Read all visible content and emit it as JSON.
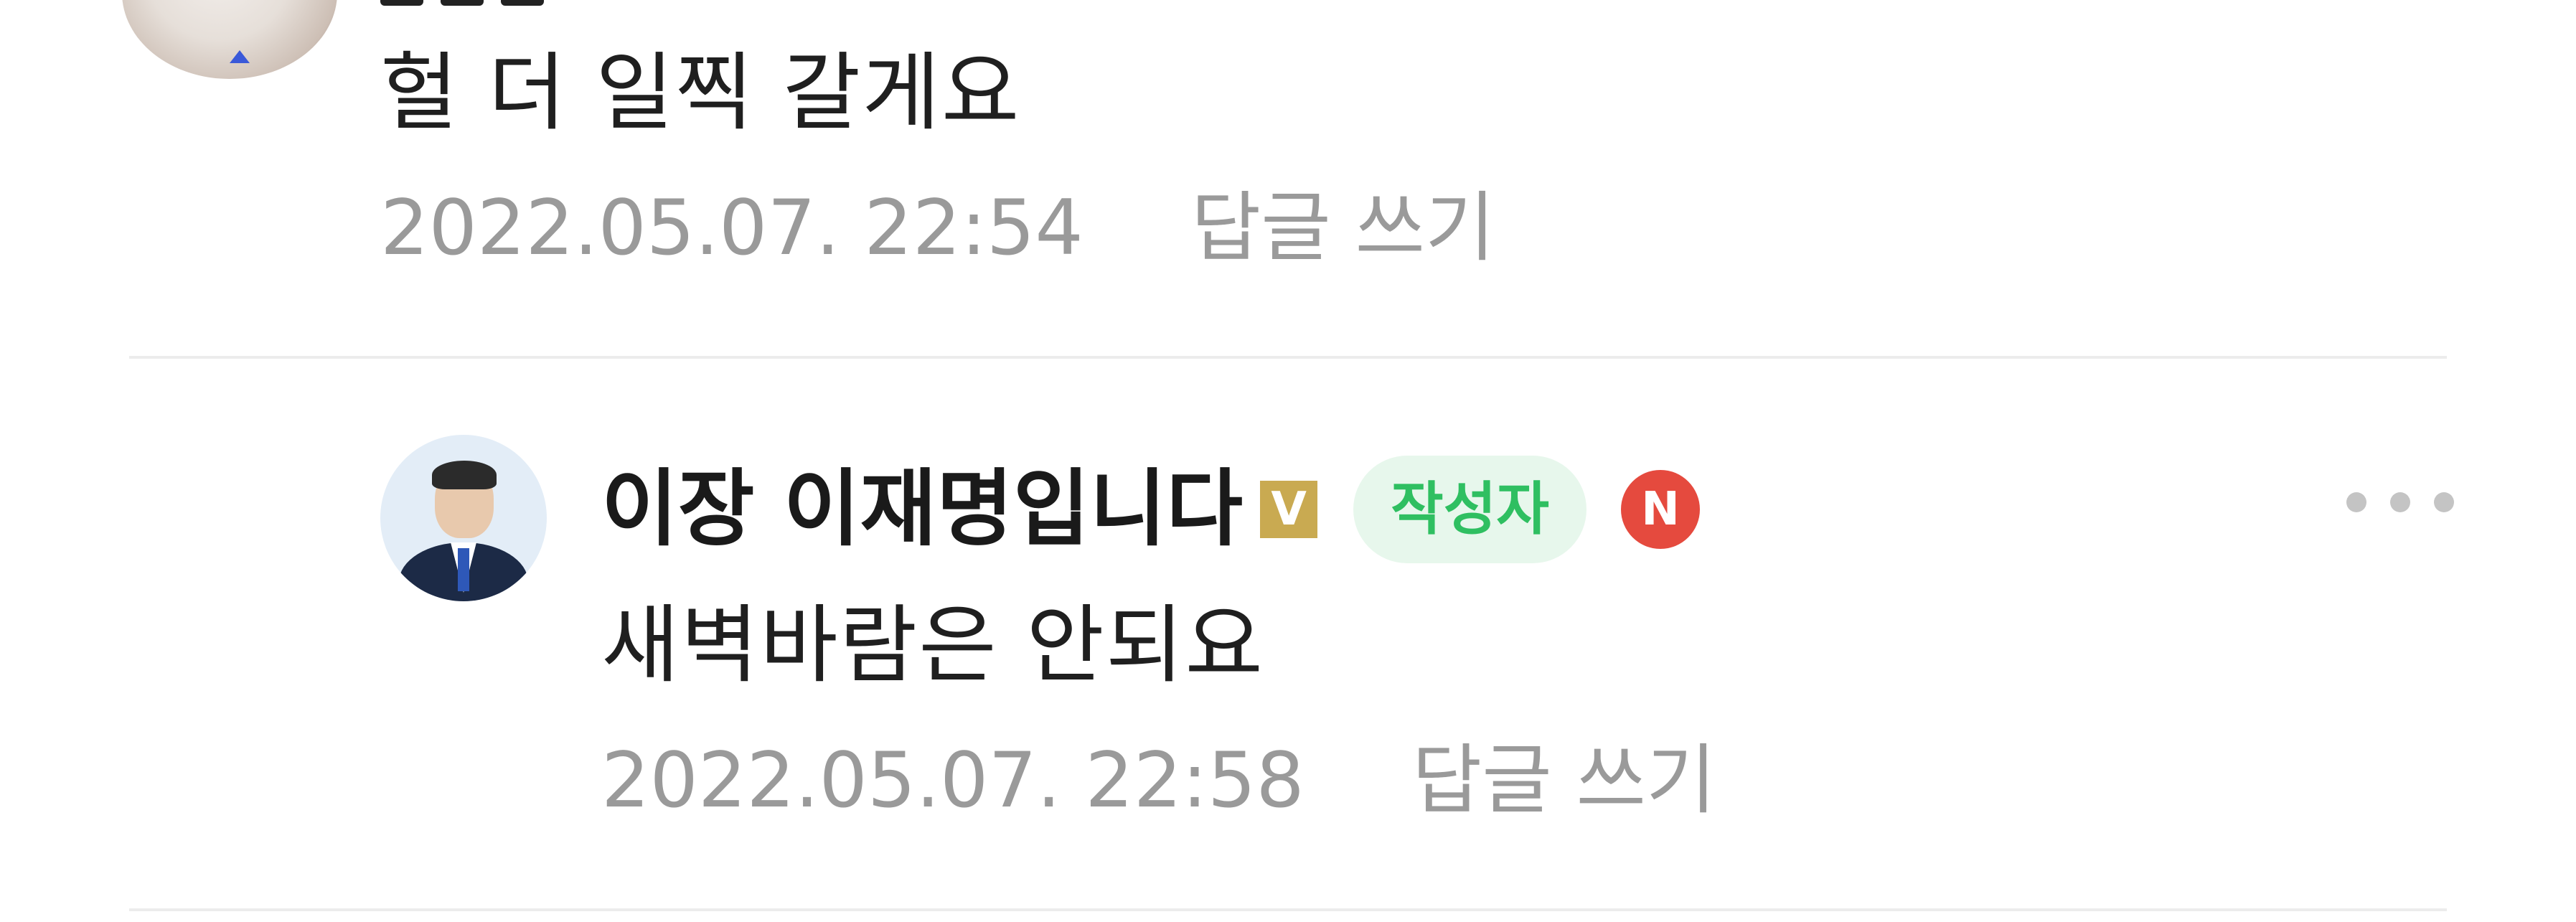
{
  "comment_top": {
    "text": "헐 더 일찍 갈게요",
    "timestamp": "2022.05.07. 22:54",
    "reply_label": "답글 쓰기"
  },
  "comment_reply": {
    "author": "이장 이재명입니다",
    "verified_mark": "V",
    "author_badge": "작성자",
    "new_badge": "N",
    "text": "새벽바람은 안되요",
    "timestamp": "2022.05.07. 22:58",
    "reply_label": "답글 쓰기",
    "more_icon": "more-horizontal-icon"
  },
  "colors": {
    "author_badge_bg": "#e7f7ec",
    "author_badge_text": "#2fbf61",
    "new_badge": "#e54a3e",
    "verified_badge": "#c9aa51",
    "meta_text": "#9a9a9a"
  }
}
